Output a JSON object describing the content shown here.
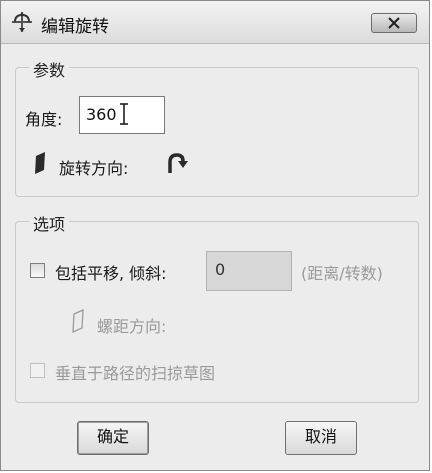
{
  "window": {
    "title": "编辑旋转",
    "close_symbol": "×",
    "title_icon": "revolve-icon"
  },
  "params": {
    "legend": "参数",
    "angle_label": "角度:",
    "angle_value": "360",
    "direction_label": "旋转方向:",
    "direction_icon": "curved-arrow-icon"
  },
  "options": {
    "legend": "选项",
    "include_translation_label": "包括平移, 倾斜:",
    "include_translation_checked": false,
    "pitch_value": "0",
    "pitch_unit": "(距离/转数)",
    "pitch_direction_label": "螺距方向:",
    "perpendicular_label": "垂直于路径的扫掠草图",
    "perpendicular_checked": false
  },
  "buttons": {
    "ok": "确定",
    "cancel": "取消"
  },
  "colors": {
    "dialog_bg": "#ececec",
    "disabled_text": "#9a9a9a",
    "disabled_field": "#d7d7d7"
  }
}
